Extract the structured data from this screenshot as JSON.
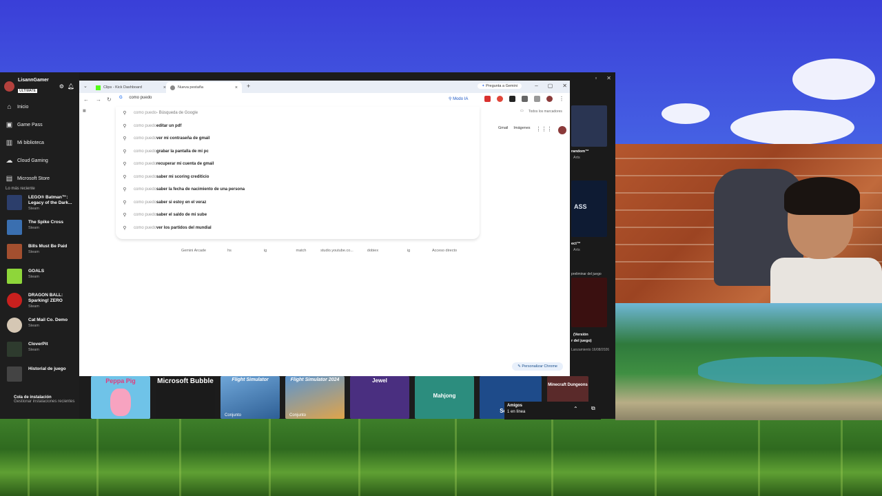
{
  "xbox": {
    "user": {
      "name": "LisannGamer",
      "badge": "ULTIMATE"
    },
    "nav": [
      {
        "label": "Inicio",
        "icon": "home-icon"
      },
      {
        "label": "Game Pass",
        "icon": "gamepass-icon"
      },
      {
        "label": "Mi biblioteca",
        "icon": "library-icon"
      },
      {
        "label": "Cloud Gaming",
        "icon": "cloud-icon"
      },
      {
        "label": "Microsoft Store",
        "icon": "store-icon"
      }
    ],
    "recent_title": "Lo más reciente",
    "recent": [
      {
        "name": "LEGO® Batman™: Legacy of the Dark...",
        "store": "Steam",
        "color": "#2c3e6b"
      },
      {
        "name": "The Spike Cross",
        "store": "Steam",
        "color": "#3a6fb0"
      },
      {
        "name": "Bills Must Be Paid",
        "store": "Steam",
        "color": "#a34f2f"
      },
      {
        "name": "GOALS",
        "store": "Steam",
        "color": "#8ed63a"
      },
      {
        "name": "DRAGON BALL: Sparking! ZERO",
        "store": "Steam",
        "color": "#c8201e"
      },
      {
        "name": "Cat Mail Co. Demo",
        "store": "Steam",
        "color": "#d5c7b4"
      },
      {
        "name": "CloverPit",
        "store": "Steam",
        "color": "#2e3b2e"
      },
      {
        "name": "Historial de juego",
        "store": "",
        "color": "#444444"
      }
    ],
    "queue": {
      "title": "Cola de instalación",
      "subtitle": "Gestionar instalaciones recientes"
    },
    "right_panel": {
      "t1": "random™",
      "t1b": "Arts",
      "t2": "ASS",
      "t2b": "ect™",
      "t2c": "Arts",
      "t3": "preliminar del juego",
      "t4": "(Versión",
      "t4b": "r del juego)",
      "t4c": "Lanzamiento 16/08/2026"
    },
    "bottom_tiles": [
      {
        "label": "Peppa Pig",
        "cap": "",
        "color": "#6fc3e8"
      },
      {
        "label": "Microsoft Bubble",
        "cap": "",
        "color": "#1b1b1b"
      },
      {
        "label": "Flight Simulator",
        "cap": "Conjunto",
        "color": "#4f86c5"
      },
      {
        "label": "Flight Simulator 2024",
        "cap": "Conjunto",
        "color": "#3d6ea8"
      },
      {
        "label": "Jewel",
        "cap": "",
        "color": "#4a2f80"
      },
      {
        "label": "Mahjong",
        "cap": "",
        "color": "#2c8d7e"
      },
      {
        "label": "Solitaire",
        "cap": "",
        "color": "#1e4b8a"
      },
      {
        "label": "Minecraft Dungeons",
        "cap": "",
        "color": "#5a2a2a"
      }
    ],
    "friends": {
      "title": "Amigos",
      "status": "1 en línea"
    }
  },
  "chrome": {
    "tabs": [
      {
        "label": "Clips - Kick Dashboard",
        "icon_color": "#53fc18"
      },
      {
        "label": "Nueva pestaña",
        "icon_color": "#4285f4"
      }
    ],
    "gemini": "Pregunta a Gemini",
    "omnibox": {
      "typed": "como puedo"
    },
    "modo_ia": "Modo IA",
    "bookmark_right": "Todos los marcadores",
    "suggestions": [
      {
        "prefix": "como puedo",
        "rest": " - Búsqueda de Google",
        "plain": true
      },
      {
        "prefix": "como puedo",
        "rest": " editar un pdf"
      },
      {
        "prefix": "como puedo",
        "rest": " ver mi contraseña de gmail"
      },
      {
        "prefix": "como puedo",
        "rest": " grabar la pantalla de mi pc"
      },
      {
        "prefix": "como puedo",
        "rest": " recuperar mi cuenta de gmail"
      },
      {
        "prefix": "como puedo",
        "rest": " saber mi scoring crediticio"
      },
      {
        "prefix": "como puedo",
        "rest": " saber la fecha de nacimiento de una persona"
      },
      {
        "prefix": "como puedo",
        "rest": " saber si estoy en el veraz"
      },
      {
        "prefix": "como puedo",
        "rest": " saber el saldo de mi sube"
      },
      {
        "prefix": "como puedo",
        "rest": " ver los partidos del mundial"
      }
    ],
    "top_links": [
      "Gmail",
      "Imágenes"
    ],
    "shortcuts": [
      "Gemini Arcade",
      "hs",
      "ig",
      "match",
      "studio.youtube.co...",
      "dobiex",
      "ig",
      "Acceso directo"
    ],
    "personalize": "Personalizar Chrome"
  }
}
